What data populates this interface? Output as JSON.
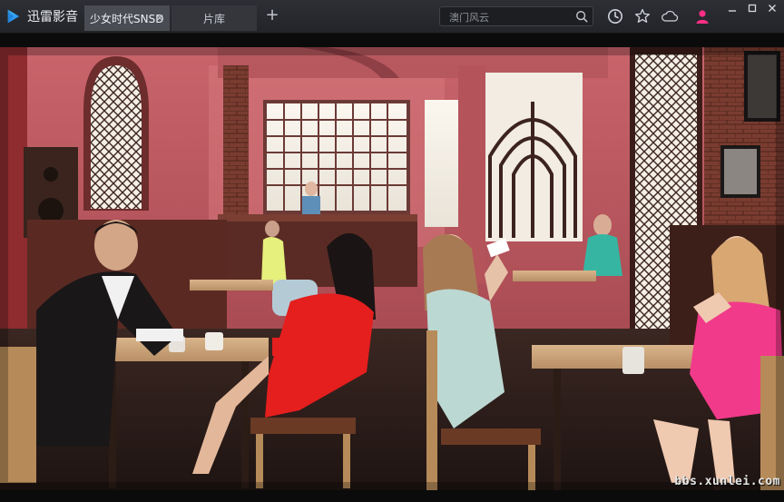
{
  "app": {
    "title": "迅雷影音"
  },
  "tabs": [
    {
      "label": "少女时代SNSD",
      "active": true
    },
    {
      "label": "片库",
      "active": false
    }
  ],
  "search": {
    "placeholder": "澳门风云"
  },
  "icons": {
    "logo": "play-logo-icon",
    "close": "close-icon",
    "newtab": "plus-icon",
    "search": "search-icon",
    "history": "clock-icon",
    "favorite": "star-icon",
    "cloud": "cloud-icon",
    "user": "user-icon",
    "minimize": "minimize-icon",
    "maximize": "maximize-icon",
    "closewin": "close-window-icon"
  },
  "colors": {
    "accent": "#1fa0ff",
    "user": "#ff2f86",
    "background": "#0b0b0c"
  },
  "video": {
    "watermark": "bbs.xunlei.com"
  }
}
